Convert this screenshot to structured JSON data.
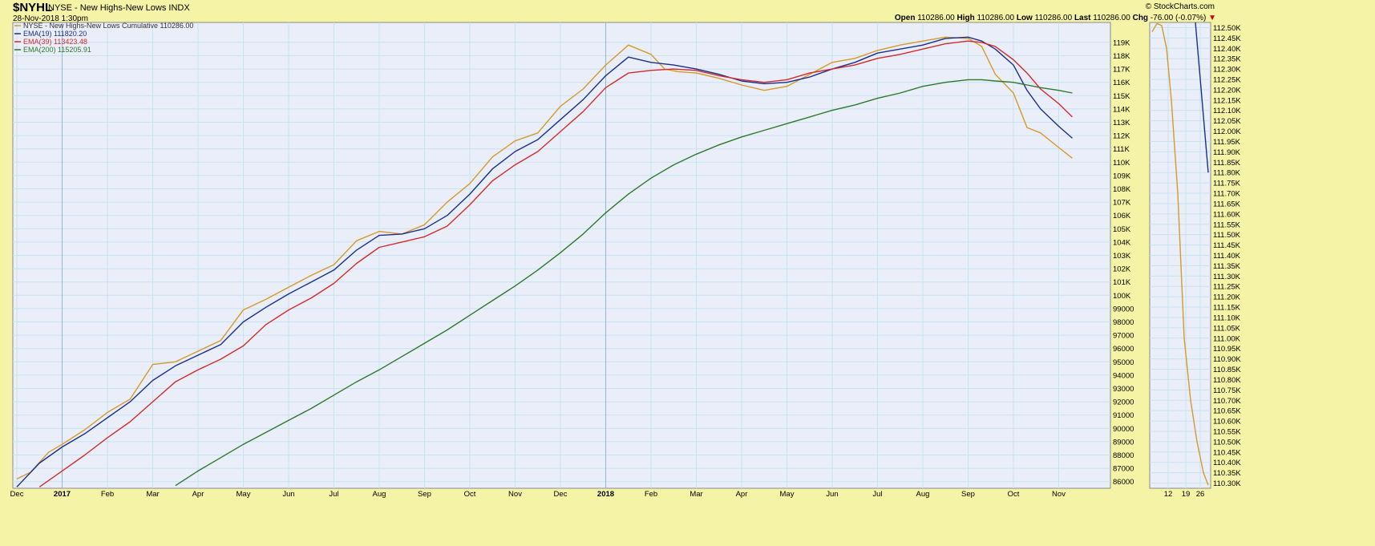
{
  "header": {
    "symbol": "$NYHL",
    "title": "NYSE - New Highs-New Lows",
    "exchange": "INDX",
    "date": "28-Nov-2018 1:30pm",
    "copyright": "© StockCharts.com",
    "open_label": "Open",
    "open": "110286.00",
    "high_label": "High",
    "high": "110286.00",
    "low_label": "Low",
    "low": "110286.00",
    "last_label": "Last",
    "last": "110286.00",
    "chg_label": "Chg",
    "chg": "-76.00 (-0.07%)"
  },
  "colors": {
    "background": "#f5f3a6",
    "plot": "#eaeef8",
    "grid": "#c8e2f0",
    "price": "#d49a2a",
    "ema19": "#1c2e8c",
    "ema39": "#d42b2b",
    "ema200": "#2b7a2b"
  },
  "chart_data": [
    {
      "type": "line",
      "title": "NYSE - New Highs-New Lows",
      "x_ticks": [
        "Dec",
        "2017",
        "Feb",
        "Mar",
        "Apr",
        "May",
        "Jun",
        "Jul",
        "Aug",
        "Sep",
        "Oct",
        "Nov",
        "Dec",
        "2018",
        "Feb",
        "Mar",
        "Apr",
        "May",
        "Jun",
        "Jul",
        "Aug",
        "Sep",
        "Oct",
        "Nov"
      ],
      "y_ticks": [
        "86000",
        "87000",
        "88000",
        "89000",
        "90000",
        "91000",
        "92000",
        "93000",
        "94000",
        "95000",
        "96000",
        "97000",
        "98000",
        "99000",
        "100K",
        "101K",
        "102K",
        "103K",
        "104K",
        "105K",
        "106K",
        "107K",
        "108K",
        "109K",
        "110K",
        "111K",
        "112K",
        "113K",
        "114K",
        "115K",
        "116K",
        "117K",
        "118K",
        "119K"
      ],
      "ylim": [
        85500,
        120500
      ],
      "grid": true,
      "legend_position": "top-left",
      "series": [
        {
          "name": "NYSE - New Highs-New Lows Cumulative 110286.00",
          "x": [
            0,
            0.3,
            0.7,
            1,
            1.5,
            2,
            2.5,
            3,
            3.5,
            4,
            4.5,
            5,
            5.5,
            6,
            6.5,
            7,
            7.5,
            8,
            8.5,
            9,
            9.5,
            10,
            10.5,
            11,
            11.5,
            12,
            12.5,
            13,
            13.5,
            14,
            14.3,
            14.6,
            15,
            15.5,
            16,
            16.5,
            17,
            17.5,
            18,
            18.5,
            19,
            19.5,
            20,
            20.5,
            21,
            21.3,
            21.6,
            22,
            22.3,
            22.6,
            23,
            23.3
          ],
          "values": [
            86200,
            86700,
            88200,
            88800,
            89900,
            91200,
            92200,
            94800,
            95000,
            95800,
            96600,
            98900,
            99700,
            100600,
            101500,
            102300,
            104100,
            104800,
            104600,
            105300,
            107000,
            108400,
            110400,
            111600,
            112200,
            114200,
            115500,
            117300,
            118800,
            118100,
            117000,
            116800,
            116700,
            116300,
            115800,
            115400,
            115700,
            116600,
            117500,
            117800,
            118400,
            118800,
            119100,
            119400,
            119300,
            118700,
            116600,
            115200,
            112600,
            112200,
            111100,
            110300
          ]
        },
        {
          "name": "EMA(19) 111820.20",
          "x": [
            0,
            0.5,
            1,
            1.5,
            2,
            2.5,
            3,
            3.5,
            4,
            4.5,
            5,
            5.5,
            6,
            6.5,
            7,
            7.5,
            8,
            8.5,
            9,
            9.5,
            10,
            10.5,
            11,
            11.5,
            12,
            12.5,
            13,
            13.5,
            14,
            14.5,
            15,
            15.5,
            16,
            16.5,
            17,
            17.5,
            18,
            18.5,
            19,
            19.5,
            20,
            20.5,
            21,
            21.3,
            21.6,
            22,
            22.3,
            22.6,
            23,
            23.3
          ],
          "values": [
            85600,
            87400,
            88600,
            89600,
            90800,
            92000,
            93600,
            94700,
            95500,
            96300,
            98000,
            99100,
            100100,
            101000,
            101900,
            103400,
            104500,
            104600,
            105000,
            106000,
            107600,
            109500,
            110800,
            111700,
            113200,
            114700,
            116500,
            117900,
            117500,
            117300,
            117000,
            116600,
            116100,
            115900,
            116000,
            116400,
            117000,
            117500,
            118200,
            118500,
            118800,
            119300,
            119400,
            119100,
            118500,
            117300,
            115400,
            114000,
            112700,
            111800
          ]
        },
        {
          "name": "EMA(39) 113423.48",
          "x": [
            0.5,
            1,
            1.5,
            2,
            2.5,
            3,
            3.5,
            4,
            4.5,
            5,
            5.5,
            6,
            6.5,
            7,
            7.5,
            8,
            8.5,
            9,
            9.5,
            10,
            10.5,
            11,
            11.5,
            12,
            12.5,
            13,
            13.5,
            14,
            14.5,
            15,
            15.5,
            16,
            16.5,
            17,
            17.5,
            18,
            18.5,
            19,
            19.5,
            20,
            20.5,
            21,
            21.3,
            21.6,
            22,
            22.3,
            22.6,
            23,
            23.3
          ],
          "values": [
            85600,
            86800,
            88000,
            89300,
            90500,
            92000,
            93500,
            94400,
            95200,
            96200,
            97800,
            98900,
            99800,
            100900,
            102400,
            103600,
            104000,
            104400,
            105200,
            106800,
            108600,
            109800,
            110800,
            112300,
            113800,
            115600,
            116700,
            116900,
            117000,
            116900,
            116500,
            116200,
            116000,
            116200,
            116700,
            117000,
            117300,
            117800,
            118100,
            118500,
            118900,
            119100,
            119000,
            118700,
            117700,
            116700,
            115500,
            114400,
            113400
          ]
        },
        {
          "name": "EMA(200) 115205.91",
          "x": [
            3.5,
            4,
            4.5,
            5,
            5.5,
            6,
            6.5,
            7,
            7.5,
            8,
            8.5,
            9,
            9.5,
            10,
            10.5,
            11,
            11.5,
            12,
            12.5,
            13,
            13.5,
            14,
            14.5,
            15,
            15.5,
            16,
            16.5,
            17,
            17.5,
            18,
            18.5,
            19,
            19.5,
            20,
            20.5,
            21,
            21.3,
            21.6,
            22,
            22.3,
            22.6,
            23,
            23.3
          ],
          "values": [
            85700,
            86800,
            87800,
            88800,
            89700,
            90600,
            91500,
            92500,
            93500,
            94400,
            95400,
            96400,
            97400,
            98500,
            99600,
            100700,
            101900,
            103200,
            104600,
            106200,
            107600,
            108800,
            109800,
            110600,
            111300,
            111900,
            112400,
            112900,
            113400,
            113900,
            114300,
            114800,
            115200,
            115700,
            116000,
            116200,
            116200,
            116100,
            116000,
            115800,
            115600,
            115400,
            115200
          ]
        }
      ]
    },
    {
      "type": "line",
      "x_ticks": [
        "12",
        "19",
        "26"
      ],
      "y_ticks": [
        "110.30K",
        "110.35K",
        "110.40K",
        "110.45K",
        "110.50K",
        "110.55K",
        "110.60K",
        "110.65K",
        "110.70K",
        "110.75K",
        "110.80K",
        "110.85K",
        "110.90K",
        "110.95K",
        "111.00K",
        "111.05K",
        "111.10K",
        "111.15K",
        "111.20K",
        "111.25K",
        "111.30K",
        "111.35K",
        "111.40K",
        "111.45K",
        "111.50K",
        "111.55K",
        "111.60K",
        "111.65K",
        "111.70K",
        "111.75K",
        "111.80K",
        "111.85K",
        "111.90K",
        "111.95K",
        "112.00K",
        "112.05K",
        "112.10K",
        "112.15K",
        "112.20K",
        "112.25K",
        "112.30K",
        "112.35K",
        "112.40K",
        "112.45K",
        "112.50K"
      ],
      "ylim": [
        110275,
        112525
      ],
      "series": [
        {
          "x": [
            0,
            0.3,
            0.6,
            0.9,
            1.2,
            1.6,
            2.0,
            2.4,
            2.8,
            3.2,
            3.5
          ],
          "values": [
            112480,
            112520,
            112510,
            112400,
            112150,
            111700,
            111000,
            110700,
            110500,
            110350,
            110290
          ]
        },
        {
          "x": [
            2.7,
            3.5
          ],
          "values": [
            112550,
            111800
          ]
        }
      ]
    }
  ],
  "legend": [
    "NYSE - New Highs-New Lows Cumulative 110286.00",
    "EMA(19) 111820.20",
    "EMA(39) 113423.48",
    "EMA(200) 115205.91"
  ]
}
